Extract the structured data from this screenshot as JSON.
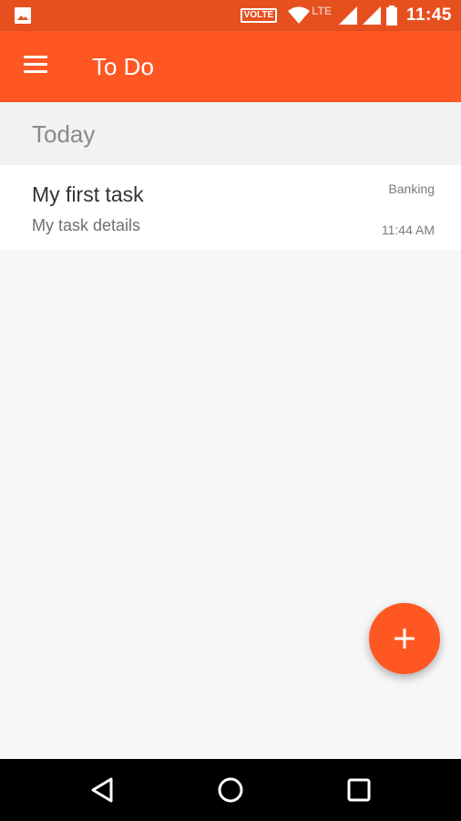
{
  "status_bar": {
    "time": "11:45",
    "volte": "VOLTE",
    "network": "LTE",
    "icons": [
      "gallery-icon",
      "wifi-icon",
      "signal-icon",
      "battery-icon"
    ]
  },
  "toolbar": {
    "title": "To Do",
    "menu_icon": "hamburger-menu-icon",
    "color": "#ff5722"
  },
  "section": {
    "title": "Today"
  },
  "tasks": [
    {
      "title": "My first task",
      "details": "My task details",
      "category": "Banking",
      "time": "11:44 AM"
    }
  ],
  "fab": {
    "icon": "plus-icon",
    "color": "#ff5722"
  },
  "nav_bar": {
    "icons": [
      "back-icon",
      "home-icon",
      "recents-icon"
    ]
  },
  "colors": {
    "status_bar": "#e6501f",
    "accent": "#ff5722",
    "background": "#f7f7f7"
  }
}
